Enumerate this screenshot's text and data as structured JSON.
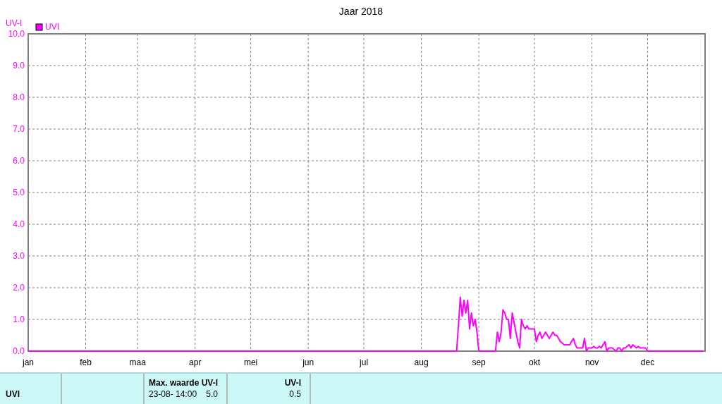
{
  "chart": {
    "chart_data": {
      "type": "line",
      "grid": true,
      "title": "Jaar 2018",
      "ylabel": "UV-I",
      "ylim": [
        0,
        10
      ],
      "categories": [
        "jan",
        null,
        null,
        null,
        null,
        null,
        null,
        null,
        null,
        null,
        null,
        null,
        null,
        null,
        null,
        null,
        null,
        null,
        null,
        null,
        null,
        null,
        null,
        null,
        null,
        null,
        null,
        null,
        null,
        null,
        null,
        "feb",
        null,
        null,
        null,
        null,
        null,
        null,
        null,
        null,
        null,
        null,
        null,
        null,
        null,
        null,
        null,
        null,
        null,
        null,
        null,
        null,
        null,
        null,
        null,
        null,
        null,
        null,
        null,
        "maa",
        null,
        null,
        null,
        null,
        null,
        null,
        null,
        null,
        null,
        null,
        null,
        null,
        null,
        null,
        null,
        null,
        null,
        null,
        null,
        null,
        null,
        null,
        null,
        null,
        null,
        null,
        null,
        null,
        null,
        null,
        "apr",
        null,
        null,
        null,
        null,
        null,
        null,
        null,
        null,
        null,
        null,
        null,
        null,
        null,
        null,
        null,
        null,
        null,
        null,
        null,
        null,
        null,
        null,
        null,
        null,
        null,
        null,
        null,
        null,
        null,
        "mei",
        null,
        null,
        null,
        null,
        null,
        null,
        null,
        null,
        null,
        null,
        null,
        null,
        null,
        null,
        null,
        null,
        null,
        null,
        null,
        null,
        null,
        null,
        null,
        null,
        null,
        null,
        null,
        null,
        null,
        null,
        "jun",
        null,
        null,
        null,
        null,
        null,
        null,
        null,
        null,
        null,
        null,
        null,
        null,
        null,
        null,
        null,
        null,
        null,
        null,
        null,
        null,
        null,
        null,
        null,
        null,
        null,
        null,
        null,
        null,
        null,
        "jul",
        null,
        null,
        null,
        null,
        null,
        null,
        null,
        null,
        null,
        null,
        null,
        null,
        null,
        null,
        null,
        null,
        null,
        null,
        null,
        null,
        null,
        null,
        null,
        null,
        null,
        null,
        null,
        null,
        null,
        null,
        "aug",
        null,
        null,
        null,
        null,
        null,
        null,
        null,
        null,
        null,
        null,
        null,
        null,
        null,
        null,
        null,
        null,
        null,
        null,
        null,
        null,
        null,
        null,
        null,
        null,
        null,
        null,
        null,
        null,
        null,
        null,
        "sep",
        null,
        null,
        null,
        null,
        null,
        null,
        null,
        null,
        null,
        null,
        null,
        null,
        null,
        null,
        null,
        null,
        null,
        null,
        null,
        null,
        null,
        null,
        null,
        null,
        null,
        null,
        null,
        null,
        null,
        "okt",
        null,
        null,
        null,
        null,
        null,
        null,
        null,
        null,
        null,
        null,
        null,
        null,
        null,
        null,
        null,
        null,
        null,
        null,
        null,
        null,
        null,
        null,
        null,
        null,
        null,
        null,
        null,
        null,
        null,
        null,
        "nov",
        null,
        null,
        null,
        null,
        null,
        null,
        null,
        null,
        null,
        null,
        null,
        null,
        null,
        null,
        null,
        null,
        null,
        null,
        null,
        null,
        null,
        null,
        null,
        null,
        null,
        null,
        null,
        null,
        null,
        "dec",
        null,
        null,
        null,
        null,
        null,
        null,
        null,
        null,
        null,
        null,
        null,
        null,
        null,
        null,
        null,
        null,
        null,
        null,
        null,
        null,
        null,
        null,
        null,
        null,
        null,
        null,
        null,
        null,
        null,
        null
      ],
      "yticks": [
        {
          "value": 0,
          "label": "0.0"
        },
        {
          "value": 1,
          "label": "1.0"
        },
        {
          "value": 2,
          "label": "2.0"
        },
        {
          "value": 3,
          "label": "3.0"
        },
        {
          "value": 4,
          "label": "4.0"
        },
        {
          "value": 5,
          "label": "5.0"
        },
        {
          "value": 6,
          "label": "6.0"
        },
        {
          "value": 7,
          "label": "7.0"
        },
        {
          "value": 8,
          "label": "8.0"
        },
        {
          "value": 9,
          "label": "9.0"
        },
        {
          "value": 10,
          "label": "10.0"
        }
      ],
      "series": [
        {
          "name": "UVI",
          "color": "#ff00ff",
          "values": [
            0,
            0,
            0,
            0,
            0,
            0,
            0,
            0,
            0,
            0,
            0,
            0,
            0,
            0,
            0,
            0,
            0,
            0,
            0,
            0,
            0,
            0,
            0,
            0,
            0,
            0,
            0,
            0,
            0,
            0,
            0,
            0,
            0,
            0,
            0,
            0,
            0,
            0,
            0,
            0,
            0,
            0,
            0,
            0,
            0,
            0,
            0,
            0,
            0,
            0,
            0,
            0,
            0,
            0,
            0,
            0,
            0,
            0,
            0,
            0,
            0,
            0,
            0,
            0,
            0,
            0,
            0,
            0,
            0,
            0,
            0,
            0,
            0,
            0,
            0,
            0,
            0,
            0,
            0,
            0,
            0,
            0,
            0,
            0,
            0,
            0,
            0,
            0,
            0,
            0,
            0,
            0,
            0,
            0,
            0,
            0,
            0,
            0,
            0,
            0,
            0,
            0,
            0,
            0,
            0,
            0,
            0,
            0,
            0,
            0,
            0,
            0,
            0,
            0,
            0,
            0,
            0,
            0,
            0,
            0,
            0,
            0,
            0,
            0,
            0,
            0,
            0,
            0,
            0,
            0,
            0,
            0,
            0,
            0,
            0,
            0,
            0,
            0,
            0,
            0,
            0,
            0,
            0,
            0,
            0,
            0,
            0,
            0,
            0,
            0,
            0,
            0,
            0,
            0,
            0,
            0,
            0,
            0,
            0,
            0,
            0,
            0,
            0,
            0,
            0,
            0,
            0,
            0,
            0,
            0,
            0,
            0,
            0,
            0,
            0,
            0,
            0,
            0,
            0,
            0,
            0,
            0,
            0,
            0,
            0,
            0,
            0,
            0,
            0,
            0,
            0,
            0,
            0,
            0,
            0,
            0,
            0,
            0,
            0,
            0,
            0,
            0,
            0,
            0,
            0,
            0,
            0,
            0,
            0,
            0,
            0,
            0,
            0,
            0,
            0,
            0,
            0,
            0,
            0,
            0,
            0,
            0,
            0,
            0,
            0,
            0,
            0,
            0,
            0,
            0,
            0,
            0,
            0.8,
            1.7,
            1.1,
            1.6,
            1.2,
            1.6,
            0.7,
            1.2,
            0.8,
            1.0,
            0.6,
            0,
            0,
            0,
            0,
            0,
            0,
            0,
            0,
            0,
            0,
            0.6,
            0.3,
            0.6,
            1.3,
            1.2,
            1.0,
            1.0,
            0.4,
            1.2,
            0.9,
            0.6,
            0.3,
            0.1,
            1.0,
            0.8,
            0.7,
            0.8,
            0.7,
            0.7,
            0.7,
            0.7,
            0.3,
            0.5,
            0.6,
            0.4,
            0.5,
            0.6,
            0.5,
            0.4,
            0.5,
            0.6,
            0.5,
            0.5,
            0.4,
            0.3,
            0.25,
            0.2,
            0.2,
            0.2,
            0.2,
            0.3,
            0.4,
            0.2,
            0.1,
            0.1,
            0.1,
            0.1,
            0.4,
            0,
            0.1,
            0.1,
            0.1,
            0.15,
            0.1,
            0.1,
            0.15,
            0.1,
            0.2,
            0.3,
            0,
            0.1,
            0.1,
            0.1,
            0.05,
            0,
            0.1,
            0.1,
            0,
            0.1,
            0.1,
            0.15,
            0.2,
            0.1,
            0.2,
            0.15,
            0.1,
            0.15,
            0.1,
            0.1,
            0.1,
            0.1,
            0,
            0,
            0,
            0,
            0,
            0,
            0,
            0,
            0,
            0,
            0,
            0,
            0,
            0,
            0,
            0,
            0,
            0,
            0,
            0,
            0,
            0,
            0,
            0,
            0,
            0,
            0,
            0,
            0,
            0,
            0
          ]
        }
      ]
    }
  },
  "summary": {
    "row_label": "UVI",
    "max_headers": [
      "Max. waarde",
      "UV-I"
    ],
    "max_date": "23-08- 14:00",
    "max_value": "5.0",
    "avg_header": "UV-I",
    "avg_value": "0.5"
  }
}
